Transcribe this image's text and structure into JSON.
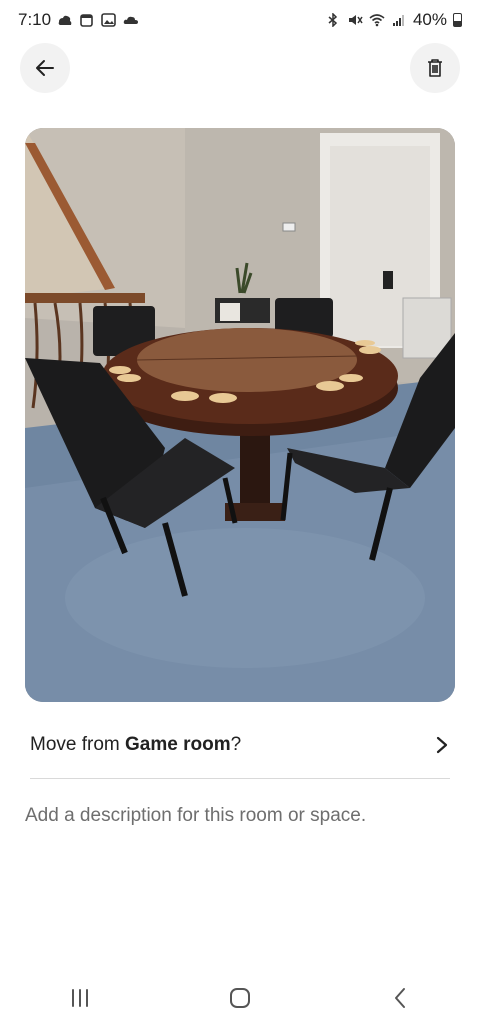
{
  "status_bar": {
    "time": "7:10",
    "battery": "40%"
  },
  "header": {
    "back_icon": "arrow-left-icon",
    "delete_icon": "trash-icon"
  },
  "photo": {
    "subject": "game room table photo"
  },
  "move": {
    "prefix": "Move from ",
    "room": "Game room",
    "suffix": "?",
    "chevron_icon": "chevron-right-icon"
  },
  "description": {
    "placeholder": "Add a description for this room or space."
  },
  "nav": {
    "recents_icon": "recents-icon",
    "home_icon": "home-icon",
    "back_icon": "back-icon"
  }
}
